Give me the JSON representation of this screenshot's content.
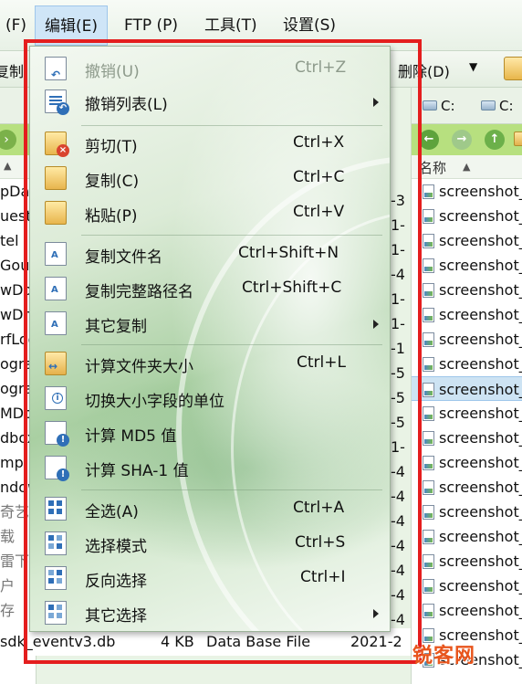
{
  "menubar": {
    "items": [
      {
        "label": "(F)"
      },
      {
        "label": "编辑(E)"
      },
      {
        "label": "FTP (P)"
      },
      {
        "label": "工具(T)"
      },
      {
        "label": "设置(S)"
      }
    ]
  },
  "toolbar": {
    "left_label": "复制",
    "delete_label": "删除(D)"
  },
  "left_pane": {
    "rows": [
      "pDat",
      "uesta",
      "tel",
      "Gou",
      "wDov",
      "wDriv",
      "rfLog",
      "ograr",
      "ograr",
      "MDov",
      "dbox",
      "mp",
      "ndow",
      "奇艺",
      "载",
      "雷下",
      "户",
      "存"
    ],
    "bottom_row": {
      "name": "sdk_eventv3.db",
      "size": "4 KB",
      "type": "Data Base File",
      "date": "2021-2"
    }
  },
  "right_pane": {
    "drive_tabs": [
      "C:",
      "C:"
    ],
    "header_name": "名称",
    "files": [
      "screenshot_",
      "screenshot_",
      "screenshot_",
      "screenshot_",
      "screenshot_",
      "screenshot_",
      "screenshot_",
      "screenshot_",
      "screenshot_",
      "screenshot_",
      "screenshot_",
      "screenshot_",
      "screenshot_",
      "screenshot_",
      "screenshot_",
      "screenshot_",
      "screenshot_",
      "screenshot_",
      "screenshot_",
      "screenshot_"
    ],
    "selected_index": 8
  },
  "mid_column": {
    "digits": [
      "-3",
      "1-",
      "1-",
      "-4",
      "1-",
      "1-",
      "-1",
      "-5",
      "-5",
      "-5",
      "1-",
      "-4",
      "-4",
      "-4",
      "-4",
      "-4",
      "-4",
      "-4"
    ]
  },
  "edit_menu": {
    "undo": {
      "label": "撤销(U)",
      "shortcut": "Ctrl+Z"
    },
    "undo_list": {
      "label": "撤销列表(L)"
    },
    "cut": {
      "label": "剪切(T)",
      "shortcut": "Ctrl+X"
    },
    "copy": {
      "label": "复制(C)",
      "shortcut": "Ctrl+C"
    },
    "paste": {
      "label": "粘贴(P)",
      "shortcut": "Ctrl+V"
    },
    "copy_filename": {
      "label": "复制文件名",
      "shortcut": "Ctrl+Shift+N"
    },
    "copy_fullpath": {
      "label": "复制完整路径名",
      "shortcut": "Ctrl+Shift+C"
    },
    "other_copy": {
      "label": "其它复制"
    },
    "calc_folder_size": {
      "label": "计算文件夹大小",
      "shortcut": "Ctrl+L"
    },
    "toggle_size_units": {
      "label": "切换大小字段的单位"
    },
    "calc_md5": {
      "label": "计算 MD5 值"
    },
    "calc_sha1": {
      "label": "计算 SHA-1 值"
    },
    "select_all": {
      "label": "全选(A)",
      "shortcut": "Ctrl+A"
    },
    "select_mode": {
      "label": "选择模式",
      "shortcut": "Ctrl+S"
    },
    "invert_selection": {
      "label": "反向选择",
      "shortcut": "Ctrl+I"
    },
    "other_select": {
      "label": "其它选择"
    }
  },
  "watermark": {
    "text": "锐客网"
  },
  "colors": {
    "highlight_frame": "#e41e1e",
    "selected_row": "#cde3f3",
    "nav_bar": "#b7e07f"
  }
}
